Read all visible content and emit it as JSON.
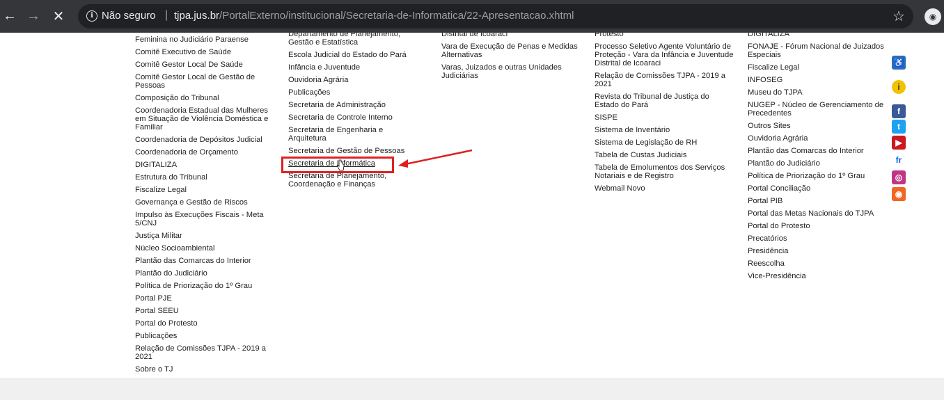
{
  "browser": {
    "security_label": "Não seguro",
    "url_host": "tjpa.jus.br",
    "url_path": "/PortalExterno/institucional/Secretaria-de-Informatica/22-Apresentacao.xhtml"
  },
  "columns": [
    {
      "items": [
        "Feminina no Judiciário Paraense",
        "Comitê Executivo de Saúde",
        "Comitê Gestor Local De Saúde",
        "Comitê Gestor Local de Gestão de Pessoas",
        "Composição do Tribunal",
        "Coordenadoria Estadual das Mulheres em Situação de Violência Doméstica e Familiar",
        "Coordenadoria de Depósitos Judicial",
        "Coordenadoria de Orçamento",
        "DIGITALIZA",
        "Estrutura do Tribunal",
        "Fiscalize Legal",
        "Governança e Gestão de Riscos",
        "Impulso às Execuções Fiscais - Meta 5/CNJ",
        "Justiça Militar",
        "Núcleo Socioambiental",
        "Plantão das Comarcas do Interior",
        "Plantão do Judiciário",
        "Política de Priorização do 1º Grau",
        "Portal PJE",
        "Portal SEEU",
        "Portal do Protesto",
        "Publicações",
        "Relação de Comissões TJPA - 2019 a 2021",
        "Sobre o TJ"
      ]
    },
    {
      "items": [
        "Departamento de Planejamento, Gestão e Estatística",
        "Escola Judicial do Estado do Pará",
        "Infância e Juventude",
        "Ouvidoria Agrária",
        "Publicações",
        "Secretaria de Administração",
        "Secretaria de Controle Interno",
        "Secretaria de Engenharia e Arquitetura",
        "Secretaria de Gestão de Pessoas",
        "Secretaria de Informática",
        "Secretaria de Planejamento, Coordenação e Finanças"
      ]
    },
    {
      "items": [
        "Distrital de Icoaraci",
        "Vara de Execução de Penas e Medidas Alternativas",
        "Varas, Juizados e outras Unidades Judiciárias"
      ]
    },
    {
      "items": [
        "Protesto",
        "Processo Seletivo Agente Voluntário de Proteção - Vara da Infância e Juventude Distrital de Icoaraci",
        "Relação de Comissões TJPA - 2019 a 2021",
        "Revista do Tribunal de Justiça do Estado do Pará",
        "SISPE",
        "Sistema de Inventário",
        "Sistema de Legislação de RH",
        "Tabela de Custas Judiciais",
        "Tabela de Emolumentos dos Serviços Notariais e de Registro",
        "Webmail Novo"
      ]
    },
    {
      "items": [
        "DIGITALIZA",
        "FONAJE - Fórum Nacional de Juizados Especiais",
        "Fiscalize Legal",
        "INFOSEG",
        "Museu do TJPA",
        "NUGEP - Núcleo de Gerenciamento de Precedentes",
        "Outros Sites",
        "Ouvidoria Agrária",
        "Plantão das Comarcas do Interior",
        "Plantão do Judiciário",
        "Política de Priorização do 1º Grau",
        "Portal Conciliação",
        "Portal PIB",
        "Portal das Metas Nacionais do TJPA",
        "Portal do Protesto",
        "Precatórios",
        "Presidência",
        "Reescolha",
        "Vice-Presidência"
      ]
    }
  ],
  "social_icons": [
    {
      "name": "accessibility-icon",
      "glyph": "♿",
      "color": "#2a6ebb"
    },
    {
      "name": "info-icon",
      "glyph": "i",
      "color": "#f2c200"
    },
    {
      "name": "facebook-icon",
      "glyph": "f",
      "color": "#3b5998"
    },
    {
      "name": "twitter-icon",
      "glyph": "t",
      "color": "#1da1f2"
    },
    {
      "name": "youtube-icon",
      "glyph": "▶",
      "color": "#cc181e"
    },
    {
      "name": "flickr-icon",
      "glyph": "fr",
      "color": "#ffffff"
    },
    {
      "name": "instagram-icon",
      "glyph": "◎",
      "color": "#c13584"
    },
    {
      "name": "rss-icon",
      "glyph": "◉",
      "color": "#f26522"
    }
  ]
}
